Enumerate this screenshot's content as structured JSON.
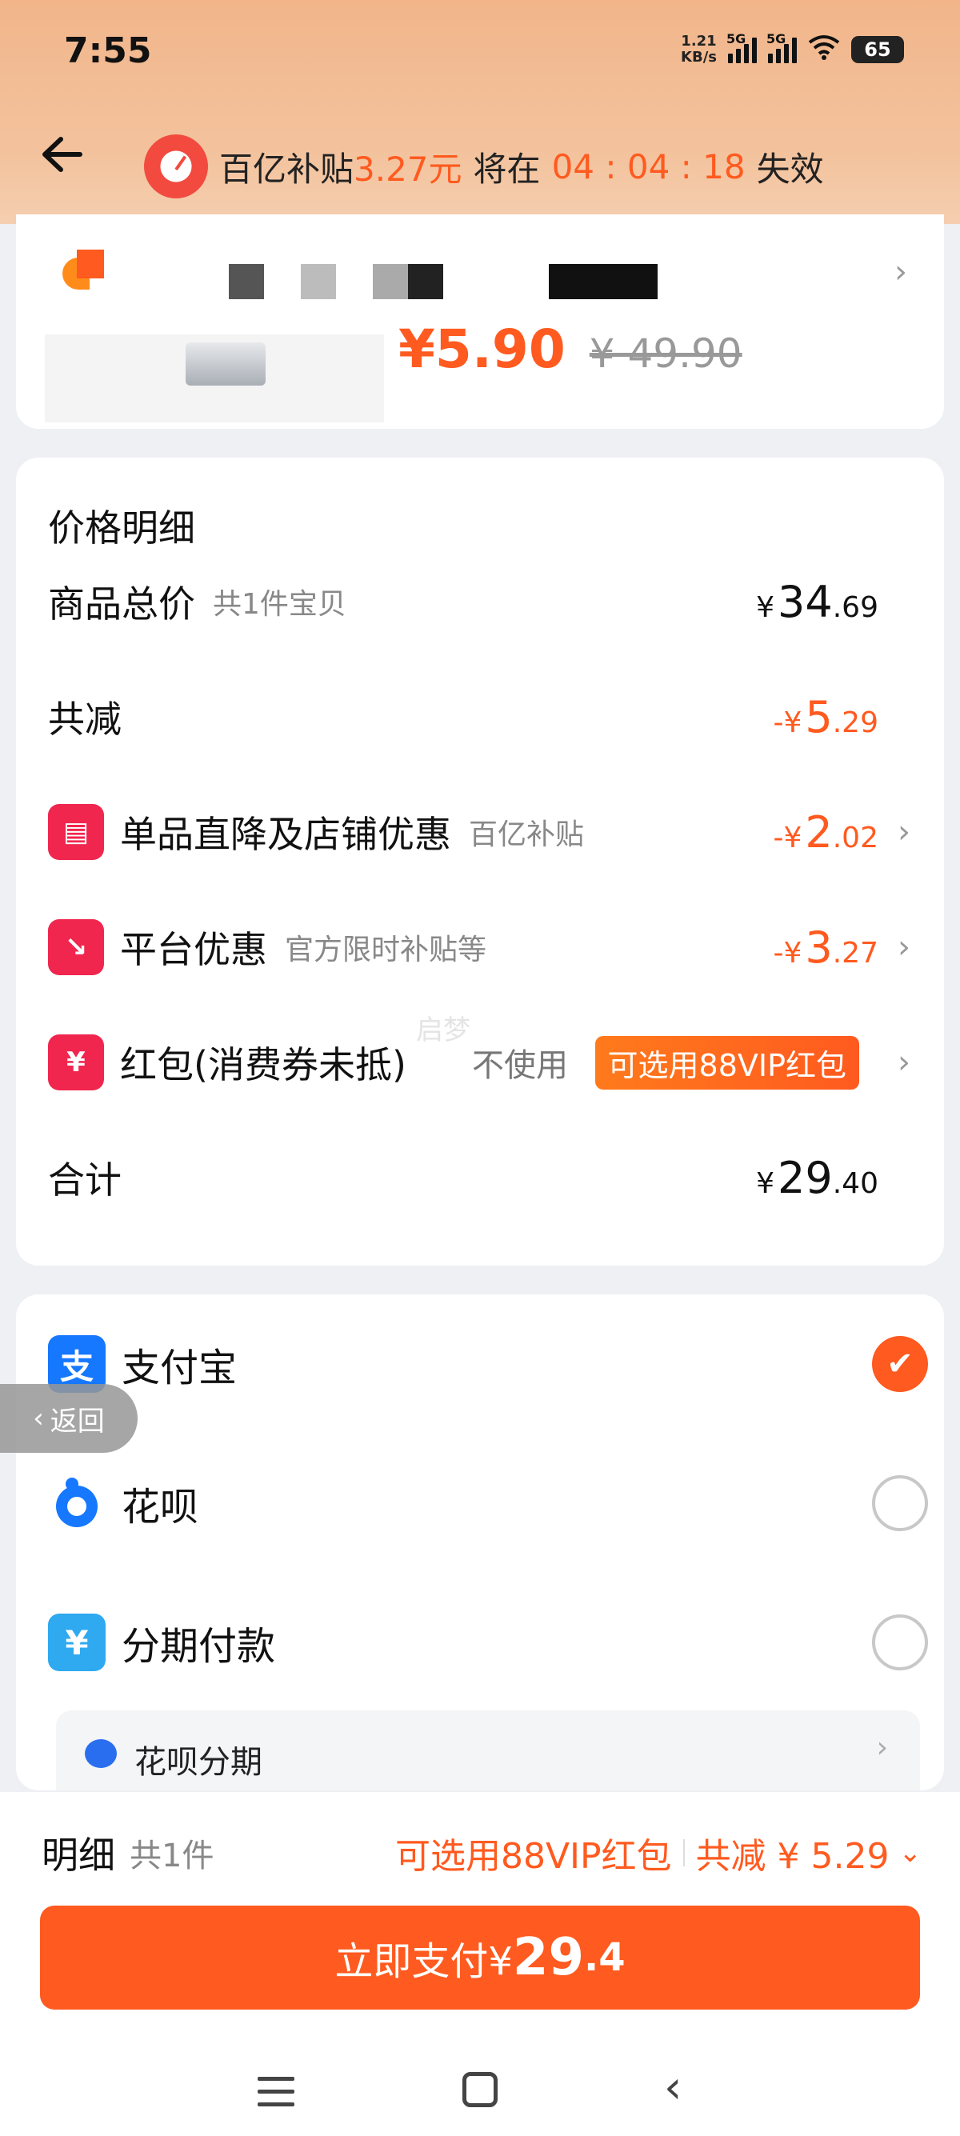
{
  "status": {
    "time": "7:55",
    "speed_value": "1.21",
    "speed_unit": "KB/s",
    "signal1_label": "5G",
    "signal2_label": "5G",
    "battery": "65"
  },
  "header": {
    "subsidy_prefix": "百亿补贴",
    "subsidy_amount": "3.27元",
    "subsidy_mid": "将在",
    "countdown": "04 : 04 : 18",
    "subsidy_suffix": "失效"
  },
  "product": {
    "price_now": "¥5.90",
    "price_old": "¥ 49.90"
  },
  "price_detail": {
    "title": "价格明细",
    "rows": [
      {
        "label": "商品总价",
        "sub": "共1件宝贝",
        "yen": "¥",
        "int": "34",
        "dec": ".69"
      },
      {
        "label": "共减",
        "sub": "",
        "yen": "-¥",
        "int": "5",
        "dec": ".29"
      },
      {
        "label": "单品直降及店铺优惠",
        "sub": "百亿补贴",
        "yen": "-¥",
        "int": "2",
        "dec": ".02"
      },
      {
        "label": "平台优惠",
        "sub": "官方限时补贴等",
        "yen": "-¥",
        "int": "3",
        "dec": ".27"
      },
      {
        "label": "红包(消费券未抵)",
        "no_use": "不使用",
        "badge": "可选用88VIP红包"
      },
      {
        "label": "合计",
        "sub": "",
        "yen": "¥",
        "int": "29",
        "dec": ".40"
      }
    ],
    "watermark": "启梦"
  },
  "payment": {
    "options": [
      {
        "label": "支付宝",
        "selected": true
      },
      {
        "label": "花呗",
        "selected": false
      },
      {
        "label": "分期付款",
        "selected": false
      }
    ],
    "huabei_installment": "花呗分期",
    "check_glyph": "✔"
  },
  "float_back": "返回",
  "bottom": {
    "detail_label": "明细",
    "count": "共1件",
    "vip_hint": "可选用88VIP红包",
    "total_reduce": "共减 ¥ 5.29",
    "pay_prefix": "立即支付¥",
    "pay_int": "29",
    "pay_dec": ".4"
  },
  "colors": {
    "accent": "#ff5a1f",
    "header_bg": "#f2b58a",
    "alipay": "#1677ff",
    "coupon_red": "#f0264e"
  }
}
